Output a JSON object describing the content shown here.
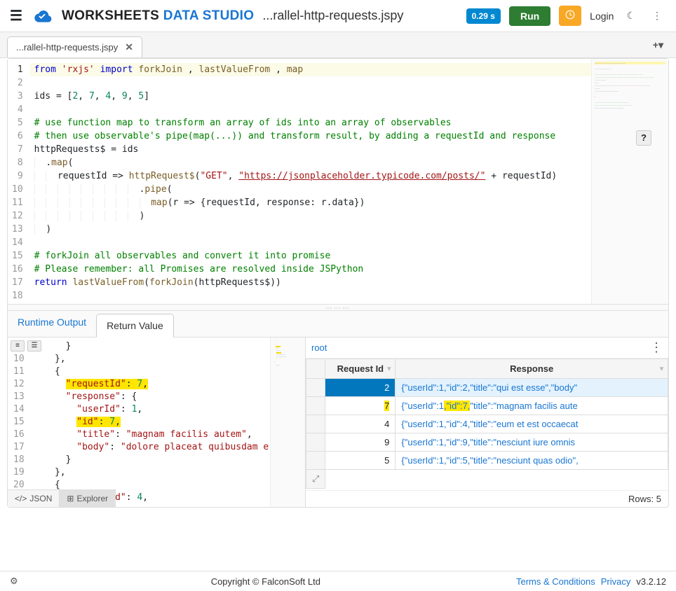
{
  "header": {
    "brand_dark": "WORKSHEETS",
    "brand_blue": "DATA STUDIO",
    "file_title": "...rallel-http-requests.jspy",
    "run_time": "0.29 s",
    "run_label": "Run",
    "login_label": "Login"
  },
  "tab": {
    "label": "...rallel-http-requests.jspy"
  },
  "editor": {
    "lines": [
      {
        "n": 1,
        "hl": true,
        "segs": [
          [
            "kw",
            "from"
          ],
          [
            "",
            " "
          ],
          [
            "str",
            "'rxjs'"
          ],
          [
            "",
            " "
          ],
          [
            "kw",
            "import"
          ],
          [
            "",
            " "
          ],
          [
            "fn",
            "forkJoin"
          ],
          [
            "",
            " , "
          ],
          [
            "fn",
            "lastValueFrom"
          ],
          [
            "",
            " , "
          ],
          [
            "fn",
            "map"
          ]
        ]
      },
      {
        "n": 2,
        "segs": []
      },
      {
        "n": 3,
        "segs": [
          [
            "",
            "ids = ["
          ],
          [
            "num",
            "2"
          ],
          [
            "",
            ", "
          ],
          [
            "num",
            "7"
          ],
          [
            "",
            ", "
          ],
          [
            "num",
            "4"
          ],
          [
            "",
            ", "
          ],
          [
            "num",
            "9"
          ],
          [
            "",
            ", "
          ],
          [
            "num",
            "5"
          ],
          [
            "",
            "]"
          ]
        ]
      },
      {
        "n": 4,
        "segs": []
      },
      {
        "n": 5,
        "segs": [
          [
            "com",
            "# use function map to transform an array of ids into an array of observables"
          ]
        ]
      },
      {
        "n": 6,
        "segs": [
          [
            "com",
            "# then use observable's pipe(map(...)) and transform result, by adding a requestId and response"
          ]
        ]
      },
      {
        "n": 7,
        "segs": [
          [
            "",
            "httpRequests$ = ids"
          ]
        ]
      },
      {
        "n": 8,
        "indent": 2,
        "segs": [
          [
            "",
            "."
          ],
          [
            "fn",
            "map"
          ],
          [
            "",
            "("
          ]
        ]
      },
      {
        "n": 9,
        "indent": 4,
        "segs": [
          [
            "",
            "requestId => "
          ],
          [
            "fn",
            "httpRequest$"
          ],
          [
            "",
            "("
          ],
          [
            "str",
            "\"GET\""
          ],
          [
            "",
            ", "
          ],
          [
            "url",
            "\"https://jsonplaceholder.typicode.com/posts/\""
          ],
          [
            "",
            " + requestId)"
          ]
        ]
      },
      {
        "n": 10,
        "indent": 18,
        "segs": [
          [
            "",
            "."
          ],
          [
            "fn",
            "pipe"
          ],
          [
            "",
            "("
          ]
        ]
      },
      {
        "n": 11,
        "indent": 20,
        "segs": [
          [
            "fn",
            "map"
          ],
          [
            "",
            "(r => {requestId, response: r.data})"
          ]
        ]
      },
      {
        "n": 12,
        "indent": 18,
        "segs": [
          [
            "",
            ")"
          ]
        ]
      },
      {
        "n": 13,
        "indent": 2,
        "segs": [
          [
            "",
            ")"
          ]
        ]
      },
      {
        "n": 14,
        "segs": []
      },
      {
        "n": 15,
        "segs": [
          [
            "com",
            "# forkJoin all observables and convert it into promise"
          ]
        ]
      },
      {
        "n": 16,
        "segs": [
          [
            "com",
            "# Please remember: all Promises are resolved inside JSPython"
          ]
        ]
      },
      {
        "n": 17,
        "segs": [
          [
            "kw",
            "return"
          ],
          [
            "",
            " "
          ],
          [
            "fn",
            "lastValueFrom"
          ],
          [
            "",
            "("
          ],
          [
            "fn",
            "forkJoin"
          ],
          [
            "",
            "(httpRequests$))"
          ]
        ]
      },
      {
        "n": 18,
        "segs": []
      }
    ]
  },
  "output": {
    "tab_runtime": "Runtime Output",
    "tab_return": "Return Value",
    "json_lines": [
      {
        "n": 9,
        "indent": 6,
        "segs": [
          [
            "",
            "}"
          ]
        ]
      },
      {
        "n": 10,
        "indent": 4,
        "segs": [
          [
            "",
            "},"
          ]
        ]
      },
      {
        "n": 11,
        "indent": 4,
        "segs": [
          [
            "",
            "{"
          ]
        ]
      },
      {
        "n": 12,
        "indent": 6,
        "segs": [
          [
            "hly",
            [
              [
                "jkey",
                "\"requestId\""
              ],
              [
                "",
                ": "
              ],
              [
                "jnum",
                "7"
              ],
              [
                "",
                ","
              ]
            ]
          ]
        ]
      },
      {
        "n": 13,
        "indent": 6,
        "segs": [
          [
            "jkey",
            "\"response\""
          ],
          [
            "",
            ": {"
          ]
        ]
      },
      {
        "n": 14,
        "indent": 8,
        "segs": [
          [
            "jkey",
            "\"userId\""
          ],
          [
            "",
            ": "
          ],
          [
            "jnum",
            "1"
          ],
          [
            "",
            ","
          ]
        ]
      },
      {
        "n": 15,
        "indent": 8,
        "segs": [
          [
            "hly",
            [
              [
                "jkey",
                "\"id\""
              ],
              [
                "",
                ": "
              ],
              [
                "jnum",
                "7"
              ],
              [
                "",
                ","
              ]
            ]
          ]
        ]
      },
      {
        "n": 16,
        "indent": 8,
        "segs": [
          [
            "jkey",
            "\"title\""
          ],
          [
            "",
            ": "
          ],
          [
            "jstr",
            "\"magnam facilis autem\""
          ],
          [
            "",
            ","
          ]
        ]
      },
      {
        "n": 17,
        "indent": 8,
        "segs": [
          [
            "jkey",
            "\"body\""
          ],
          [
            "",
            ": "
          ],
          [
            "jstr",
            "\"dolore placeat quibusdam e"
          ]
        ]
      },
      {
        "n": 18,
        "indent": 6,
        "segs": [
          [
            "",
            "}"
          ]
        ]
      },
      {
        "n": 19,
        "indent": 4,
        "segs": [
          [
            "",
            "},"
          ]
        ]
      },
      {
        "n": 20,
        "indent": 4,
        "segs": [
          [
            "",
            "{"
          ]
        ]
      },
      {
        "n": 21,
        "indent": 6,
        "segs": [
          [
            "jkey",
            "\"requestId\""
          ],
          [
            "",
            ": "
          ],
          [
            "jnum",
            "4"
          ],
          [
            "",
            ","
          ]
        ]
      }
    ],
    "view_json": "JSON",
    "view_explorer": "Explorer",
    "breadcrumb": "root",
    "col_request_id": "Request Id",
    "col_response": "Response",
    "rows": [
      {
        "id": "2",
        "sel": true,
        "resp": "{\"userId\":1,\"id\":2,\"title\":\"qui est esse\",\"body\""
      },
      {
        "id": "7",
        "id_hl": true,
        "resp_pre": "{\"userId\":1",
        "resp_hl": ",\"id\":7,",
        "resp_post": "\"title\":\"magnam facilis aute"
      },
      {
        "id": "4",
        "resp": "{\"userId\":1,\"id\":4,\"title\":\"eum et est occaecat"
      },
      {
        "id": "9",
        "resp": "{\"userId\":1,\"id\":9,\"title\":\"nesciunt iure omnis"
      },
      {
        "id": "5",
        "resp": "{\"userId\":1,\"id\":5,\"title\":\"nesciunt quas odio\","
      }
    ],
    "rows_label": "Rows: 5"
  },
  "footer": {
    "copyright": "Copyright © FalconSoft Ltd",
    "terms": "Terms & Conditions",
    "privacy": "Privacy",
    "version": "v3.2.12"
  }
}
